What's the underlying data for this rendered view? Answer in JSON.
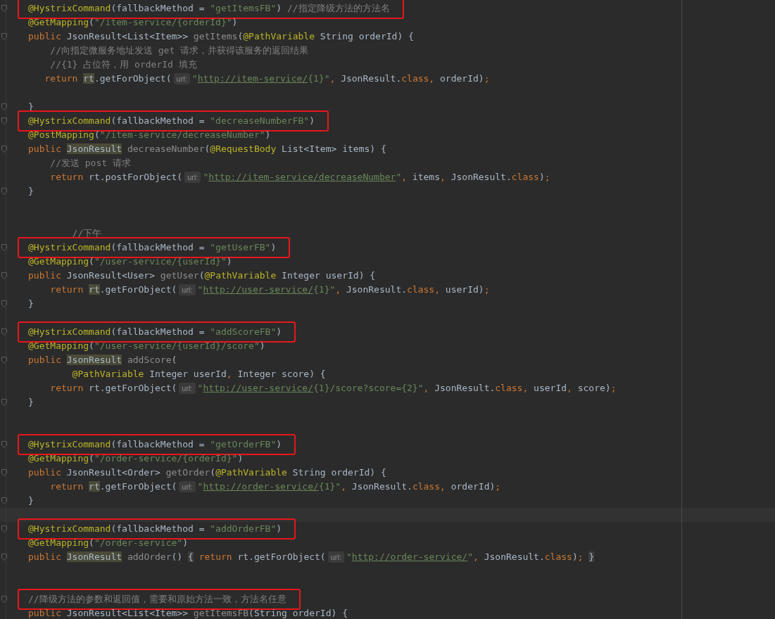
{
  "editor": {
    "lines": [
      {
        "kind": "code",
        "fold": true,
        "boxed": true,
        "tokens": [
          {
            "kind": "annotation",
            "text": "@HystrixCommand"
          },
          {
            "kind": "plain",
            "text": "(fallbackMethod = "
          },
          {
            "kind": "string",
            "text": "\"getItemsFB\""
          },
          {
            "kind": "plain",
            "text": ") "
          },
          {
            "kind": "comment",
            "text": "//指定降级方法的方法名"
          }
        ]
      },
      {
        "kind": "code",
        "tokens": [
          {
            "kind": "annotation",
            "text": "@GetMapping"
          },
          {
            "kind": "plain",
            "text": "("
          },
          {
            "kind": "string",
            "text": "\"/item-service/{orderId}\""
          },
          {
            "kind": "plain",
            "text": ")"
          }
        ]
      },
      {
        "kind": "code",
        "fold": true,
        "tokens": [
          {
            "kind": "keyword",
            "text": "public "
          },
          {
            "kind": "plain",
            "text": "JsonResult<List<Item>> "
          },
          {
            "kind": "unused",
            "text": "getItems"
          },
          {
            "kind": "plain",
            "text": "("
          },
          {
            "kind": "annotation",
            "text": "@PathVariable "
          },
          {
            "kind": "plain",
            "text": "String orderId) {"
          }
        ]
      },
      {
        "kind": "code",
        "tokens": [
          {
            "kind": "comment",
            "text": "    //向指定微服务地址发送 get 请求，并获得该服务的返回结果"
          }
        ]
      },
      {
        "kind": "code",
        "tokens": [
          {
            "kind": "comment",
            "text": "    //{1} 占位符，用 orderId 填充"
          }
        ]
      },
      {
        "kind": "code",
        "tokens": [
          {
            "kind": "keyword",
            "text": "   return "
          },
          {
            "kind": "ref",
            "text": "rt"
          },
          {
            "kind": "plain",
            "text": ".getForObject("
          },
          {
            "kind": "hint",
            "text": "url:"
          },
          {
            "kind": "string",
            "text": "\""
          },
          {
            "kind": "url",
            "text": "http://item-service/"
          },
          {
            "kind": "string",
            "text": "{1}\""
          },
          {
            "kind": "keyword",
            "text": ", "
          },
          {
            "kind": "plain",
            "text": "JsonResult."
          },
          {
            "kind": "keyword",
            "text": "class, "
          },
          {
            "kind": "plain",
            "text": "orderId)"
          },
          {
            "kind": "keyword",
            "text": ";"
          }
        ]
      },
      {
        "kind": "blank"
      },
      {
        "kind": "code",
        "fold": true,
        "tokens": [
          {
            "kind": "plain",
            "text": "}"
          }
        ]
      },
      {
        "kind": "code",
        "fold": true,
        "boxed": true,
        "tokens": [
          {
            "kind": "annotation",
            "text": "@HystrixCommand"
          },
          {
            "kind": "plain",
            "text": "(fallbackMethod = "
          },
          {
            "kind": "string",
            "text": "\"decreaseNumberFB\""
          },
          {
            "kind": "plain",
            "text": ")"
          }
        ]
      },
      {
        "kind": "code",
        "tokens": [
          {
            "kind": "annotation",
            "text": "@PostMapping"
          },
          {
            "kind": "plain",
            "text": "("
          },
          {
            "kind": "string",
            "text": "\"/item-service/decreaseNumber\""
          },
          {
            "kind": "plain",
            "text": ")"
          }
        ]
      },
      {
        "kind": "code",
        "fold": true,
        "tokens": [
          {
            "kind": "keyword",
            "text": "public "
          },
          {
            "kind": "ref",
            "text": "JsonResult"
          },
          {
            "kind": "unused",
            "text": " decreaseNumber"
          },
          {
            "kind": "plain",
            "text": "("
          },
          {
            "kind": "annotation",
            "text": "@RequestBody "
          },
          {
            "kind": "plain",
            "text": "List<Item> items) {"
          }
        ]
      },
      {
        "kind": "code",
        "tokens": [
          {
            "kind": "comment",
            "text": "    //发送 post 请求"
          }
        ]
      },
      {
        "kind": "code",
        "tokens": [
          {
            "kind": "keyword",
            "text": "    return "
          },
          {
            "kind": "plain",
            "text": "rt.postForObject("
          },
          {
            "kind": "hint",
            "text": "url:"
          },
          {
            "kind": "string",
            "text": "\""
          },
          {
            "kind": "url",
            "text": "http://item-service/decreaseNumber"
          },
          {
            "kind": "string",
            "text": "\""
          },
          {
            "kind": "keyword",
            "text": ", "
          },
          {
            "kind": "plain",
            "text": "items"
          },
          {
            "kind": "keyword",
            "text": ", "
          },
          {
            "kind": "plain",
            "text": "JsonResult."
          },
          {
            "kind": "keyword",
            "text": "class"
          },
          {
            "kind": "plain",
            "text": ")"
          },
          {
            "kind": "keyword",
            "text": ";"
          }
        ]
      },
      {
        "kind": "code",
        "fold": true,
        "tokens": [
          {
            "kind": "plain",
            "text": "}"
          }
        ]
      },
      {
        "kind": "blank"
      },
      {
        "kind": "blank"
      },
      {
        "kind": "code",
        "tokens": [
          {
            "kind": "comment",
            "text": "        //下午"
          }
        ]
      },
      {
        "kind": "code",
        "fold": true,
        "boxed": true,
        "tokens": [
          {
            "kind": "annotation",
            "text": "@HystrixCommand"
          },
          {
            "kind": "plain",
            "text": "(fallbackMethod = "
          },
          {
            "kind": "string",
            "text": "\"getUserFB\""
          },
          {
            "kind": "plain",
            "text": ")"
          }
        ]
      },
      {
        "kind": "code",
        "tokens": [
          {
            "kind": "annotation",
            "text": "@GetMapping"
          },
          {
            "kind": "plain",
            "text": "("
          },
          {
            "kind": "string",
            "text": "\"/user-service/{userId}\""
          },
          {
            "kind": "plain",
            "text": ")"
          }
        ]
      },
      {
        "kind": "code",
        "fold": true,
        "tokens": [
          {
            "kind": "keyword",
            "text": "public "
          },
          {
            "kind": "plain",
            "text": "JsonResult<User> "
          },
          {
            "kind": "unused",
            "text": "getUser"
          },
          {
            "kind": "plain",
            "text": "("
          },
          {
            "kind": "annotation",
            "text": "@PathVariable "
          },
          {
            "kind": "plain",
            "text": "Integer userId) {"
          }
        ]
      },
      {
        "kind": "code",
        "tokens": [
          {
            "kind": "keyword",
            "text": "    return "
          },
          {
            "kind": "ref",
            "text": "rt"
          },
          {
            "kind": "plain",
            "text": ".getForObject("
          },
          {
            "kind": "hint",
            "text": "url:"
          },
          {
            "kind": "string",
            "text": "\""
          },
          {
            "kind": "url",
            "text": "http://user-service/"
          },
          {
            "kind": "string",
            "text": "{1}\""
          },
          {
            "kind": "keyword",
            "text": ", "
          },
          {
            "kind": "plain",
            "text": "JsonResult."
          },
          {
            "kind": "keyword",
            "text": "class, "
          },
          {
            "kind": "plain",
            "text": "userId)"
          },
          {
            "kind": "keyword",
            "text": ";"
          }
        ]
      },
      {
        "kind": "code",
        "fold": true,
        "tokens": [
          {
            "kind": "plain",
            "text": "}"
          }
        ]
      },
      {
        "kind": "blank"
      },
      {
        "kind": "code",
        "fold": true,
        "boxed": true,
        "tokens": [
          {
            "kind": "annotation",
            "text": "@HystrixCommand"
          },
          {
            "kind": "plain",
            "text": "(fallbackMethod = "
          },
          {
            "kind": "string",
            "text": "\"addScoreFB\""
          },
          {
            "kind": "plain",
            "text": ")"
          }
        ]
      },
      {
        "kind": "code",
        "tokens": [
          {
            "kind": "annotation",
            "text": "@GetMapping"
          },
          {
            "kind": "plain",
            "text": "("
          },
          {
            "kind": "string",
            "text": "\"/user-service/{userId}/score\""
          },
          {
            "kind": "plain",
            "text": ")"
          }
        ]
      },
      {
        "kind": "code",
        "fold": true,
        "tokens": [
          {
            "kind": "keyword",
            "text": "public "
          },
          {
            "kind": "ref",
            "text": "JsonResult"
          },
          {
            "kind": "unused",
            "text": " addScore"
          },
          {
            "kind": "plain",
            "text": "("
          }
        ]
      },
      {
        "kind": "code",
        "tokens": [
          {
            "kind": "annotation",
            "text": "        @PathVariable "
          },
          {
            "kind": "plain",
            "text": "Integer userId"
          },
          {
            "kind": "keyword",
            "text": ", "
          },
          {
            "kind": "plain",
            "text": "Integer score) {"
          }
        ]
      },
      {
        "kind": "code",
        "tokens": [
          {
            "kind": "keyword",
            "text": "    return "
          },
          {
            "kind": "plain",
            "text": "rt.getForObject("
          },
          {
            "kind": "hint",
            "text": "url:"
          },
          {
            "kind": "string",
            "text": "\""
          },
          {
            "kind": "url",
            "text": "http://user-service/"
          },
          {
            "kind": "string",
            "text": "{1}/score?score={2}\""
          },
          {
            "kind": "keyword",
            "text": ", "
          },
          {
            "kind": "plain",
            "text": "JsonResult."
          },
          {
            "kind": "keyword",
            "text": "class, "
          },
          {
            "kind": "plain",
            "text": "userId"
          },
          {
            "kind": "keyword",
            "text": ", "
          },
          {
            "kind": "plain",
            "text": "score)"
          },
          {
            "kind": "keyword",
            "text": ";"
          }
        ]
      },
      {
        "kind": "code",
        "fold": true,
        "tokens": [
          {
            "kind": "plain",
            "text": "}"
          }
        ]
      },
      {
        "kind": "blank"
      },
      {
        "kind": "blank"
      },
      {
        "kind": "code",
        "fold": true,
        "boxed": true,
        "tokens": [
          {
            "kind": "annotation",
            "text": "@HystrixCommand"
          },
          {
            "kind": "plain",
            "text": "(fallbackMethod = "
          },
          {
            "kind": "string",
            "text": "\"getOrderFB\""
          },
          {
            "kind": "plain",
            "text": ")"
          }
        ]
      },
      {
        "kind": "code",
        "tokens": [
          {
            "kind": "annotation",
            "text": "@GetMapping"
          },
          {
            "kind": "plain",
            "text": "("
          },
          {
            "kind": "string",
            "text": "\"/order-service/{orderId}\""
          },
          {
            "kind": "plain",
            "text": ")"
          }
        ]
      },
      {
        "kind": "code",
        "fold": true,
        "tokens": [
          {
            "kind": "keyword",
            "text": "public "
          },
          {
            "kind": "plain",
            "text": "JsonResult<Order> "
          },
          {
            "kind": "unused",
            "text": "getOrder"
          },
          {
            "kind": "plain",
            "text": "("
          },
          {
            "kind": "annotation",
            "text": "@PathVariable "
          },
          {
            "kind": "plain",
            "text": "String orderId) {"
          }
        ]
      },
      {
        "kind": "code",
        "tokens": [
          {
            "kind": "keyword",
            "text": "    return "
          },
          {
            "kind": "ref",
            "text": "rt"
          },
          {
            "kind": "plain",
            "text": ".getForObject("
          },
          {
            "kind": "hint",
            "text": "url:"
          },
          {
            "kind": "string",
            "text": "\""
          },
          {
            "kind": "url",
            "text": "http://order-service/"
          },
          {
            "kind": "string",
            "text": "{1}\""
          },
          {
            "kind": "keyword",
            "text": ", "
          },
          {
            "kind": "plain",
            "text": "JsonResult."
          },
          {
            "kind": "keyword",
            "text": "class, "
          },
          {
            "kind": "plain",
            "text": "orderId)"
          },
          {
            "kind": "keyword",
            "text": ";"
          }
        ]
      },
      {
        "kind": "code",
        "fold": true,
        "tokens": [
          {
            "kind": "plain",
            "text": "}"
          }
        ]
      },
      {
        "kind": "blank",
        "current": true
      },
      {
        "kind": "code",
        "fold": true,
        "boxed": true,
        "tokens": [
          {
            "kind": "annotation",
            "text": "@HystrixCommand"
          },
          {
            "kind": "plain",
            "text": "(fallbackMethod = "
          },
          {
            "kind": "string",
            "text": "\"addOrderFB\""
          },
          {
            "kind": "plain",
            "text": ")"
          }
        ]
      },
      {
        "kind": "code",
        "tokens": [
          {
            "kind": "annotation",
            "text": "@GetMapping"
          },
          {
            "kind": "plain",
            "text": "("
          },
          {
            "kind": "string",
            "text": "\"/order-service\""
          },
          {
            "kind": "plain",
            "text": ")"
          }
        ]
      },
      {
        "kind": "code",
        "fold": true,
        "tokens": [
          {
            "kind": "keyword",
            "text": "public "
          },
          {
            "kind": "ref",
            "text": "JsonResult"
          },
          {
            "kind": "unused",
            "text": " addOrder"
          },
          {
            "kind": "plain",
            "text": "() "
          },
          {
            "kind": "brace",
            "text": "{"
          },
          {
            "kind": "keyword",
            "text": " return "
          },
          {
            "kind": "plain",
            "text": "rt.getForObject("
          },
          {
            "kind": "hint",
            "text": "url:"
          },
          {
            "kind": "string",
            "text": "\""
          },
          {
            "kind": "url",
            "text": "http://order-service/"
          },
          {
            "kind": "string",
            "text": "\""
          },
          {
            "kind": "keyword",
            "text": ", "
          },
          {
            "kind": "plain",
            "text": "JsonResult."
          },
          {
            "kind": "keyword",
            "text": "class"
          },
          {
            "kind": "plain",
            "text": ")"
          },
          {
            "kind": "keyword",
            "text": "; "
          },
          {
            "kind": "brace",
            "text": "}"
          }
        ]
      },
      {
        "kind": "blank"
      },
      {
        "kind": "blank"
      },
      {
        "kind": "code",
        "fold": true,
        "boxed": true,
        "tokens": [
          {
            "kind": "comment",
            "text": "//降级方法的参数和返回值，需要和原始方法一致，方法名任意"
          }
        ]
      },
      {
        "kind": "code",
        "tokens": [
          {
            "kind": "keyword",
            "text": "public "
          },
          {
            "kind": "plain",
            "text": "JsonResult<List<Item>> "
          },
          {
            "kind": "unused",
            "text": "getItemsFB"
          },
          {
            "kind": "plain",
            "text": "(String orderId) {"
          }
        ]
      }
    ]
  }
}
